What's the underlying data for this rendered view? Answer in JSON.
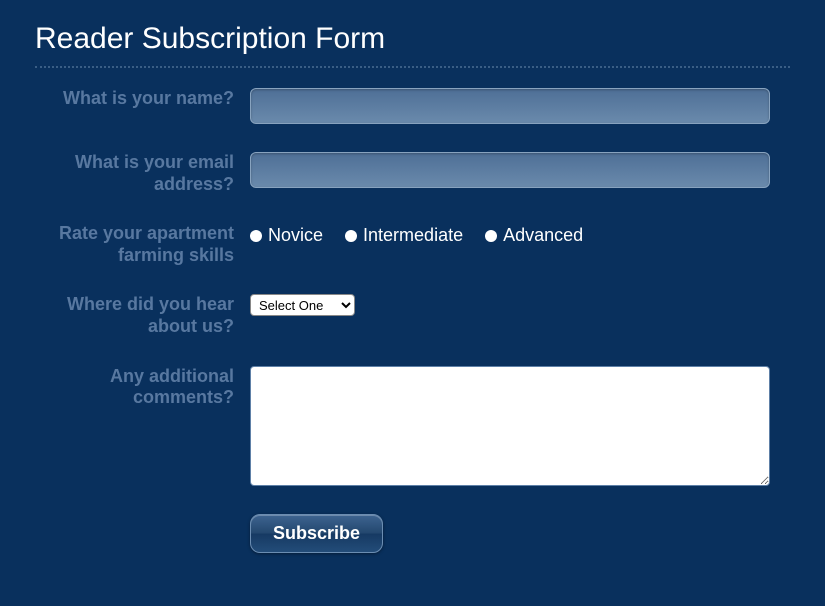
{
  "title": "Reader Subscription Form",
  "fields": {
    "name": {
      "label": "What is your name?",
      "value": ""
    },
    "email": {
      "label": "What is your email address?",
      "value": ""
    },
    "skills": {
      "label": "Rate your apartment farming skills",
      "options": {
        "novice": "Novice",
        "intermediate": "Intermediate",
        "advanced": "Advanced"
      }
    },
    "source": {
      "label": "Where did you hear about us?",
      "selected": "Select One"
    },
    "comments": {
      "label": "Any additional comments?",
      "value": ""
    }
  },
  "submit_label": "Subscribe"
}
